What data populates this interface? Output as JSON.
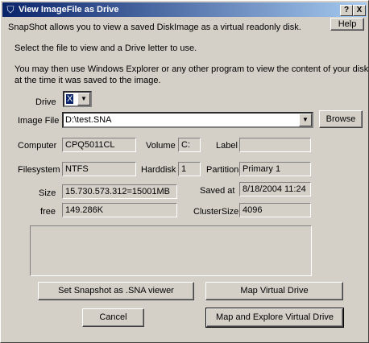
{
  "title": "View ImageFile as Drive",
  "caption_buttons": {
    "help": "?",
    "close": "X"
  },
  "help_label": "Help",
  "intro": {
    "line1": "SnapShot allows you to view a saved DiskImage as a virtual readonly disk.",
    "line2": "Select the file to view and a Drive letter to use.",
    "line3": "You may then use Windows Explorer or any other program to view the content of your disk",
    "line4": "at the time it was saved to the image."
  },
  "drive": {
    "label": "Drive",
    "value": "X"
  },
  "image_file": {
    "label": "Image File",
    "value": "D:\\test.SNA",
    "browse_label": "Browse"
  },
  "info": {
    "computer_label": "Computer",
    "computer": "CPQ5011CL",
    "volume_label": "Volume",
    "volume": "C:",
    "label_label": "Label",
    "label": "",
    "filesystem_label": "Filesystem",
    "filesystem": "NTFS",
    "harddisk_label": "Harddisk",
    "harddisk": "1",
    "partition_label": "Partition",
    "partition": "Primary 1",
    "size_label": "Size",
    "size": "15.730.573.312=15001MB",
    "saved_label": "Saved at",
    "saved": "8/18/2004 11:24",
    "free_label": "free",
    "free": "149.286K",
    "cluster_label": "ClusterSize",
    "cluster": "4096"
  },
  "buttons": {
    "set_viewer": "Set Snapshot as .SNA viewer",
    "map": "Map Virtual Drive",
    "cancel": "Cancel",
    "map_explore": "Map and Explore Virtual Drive"
  },
  "icons": {
    "app": "drive-app-icon",
    "dropdown": "chevron-down-icon"
  }
}
